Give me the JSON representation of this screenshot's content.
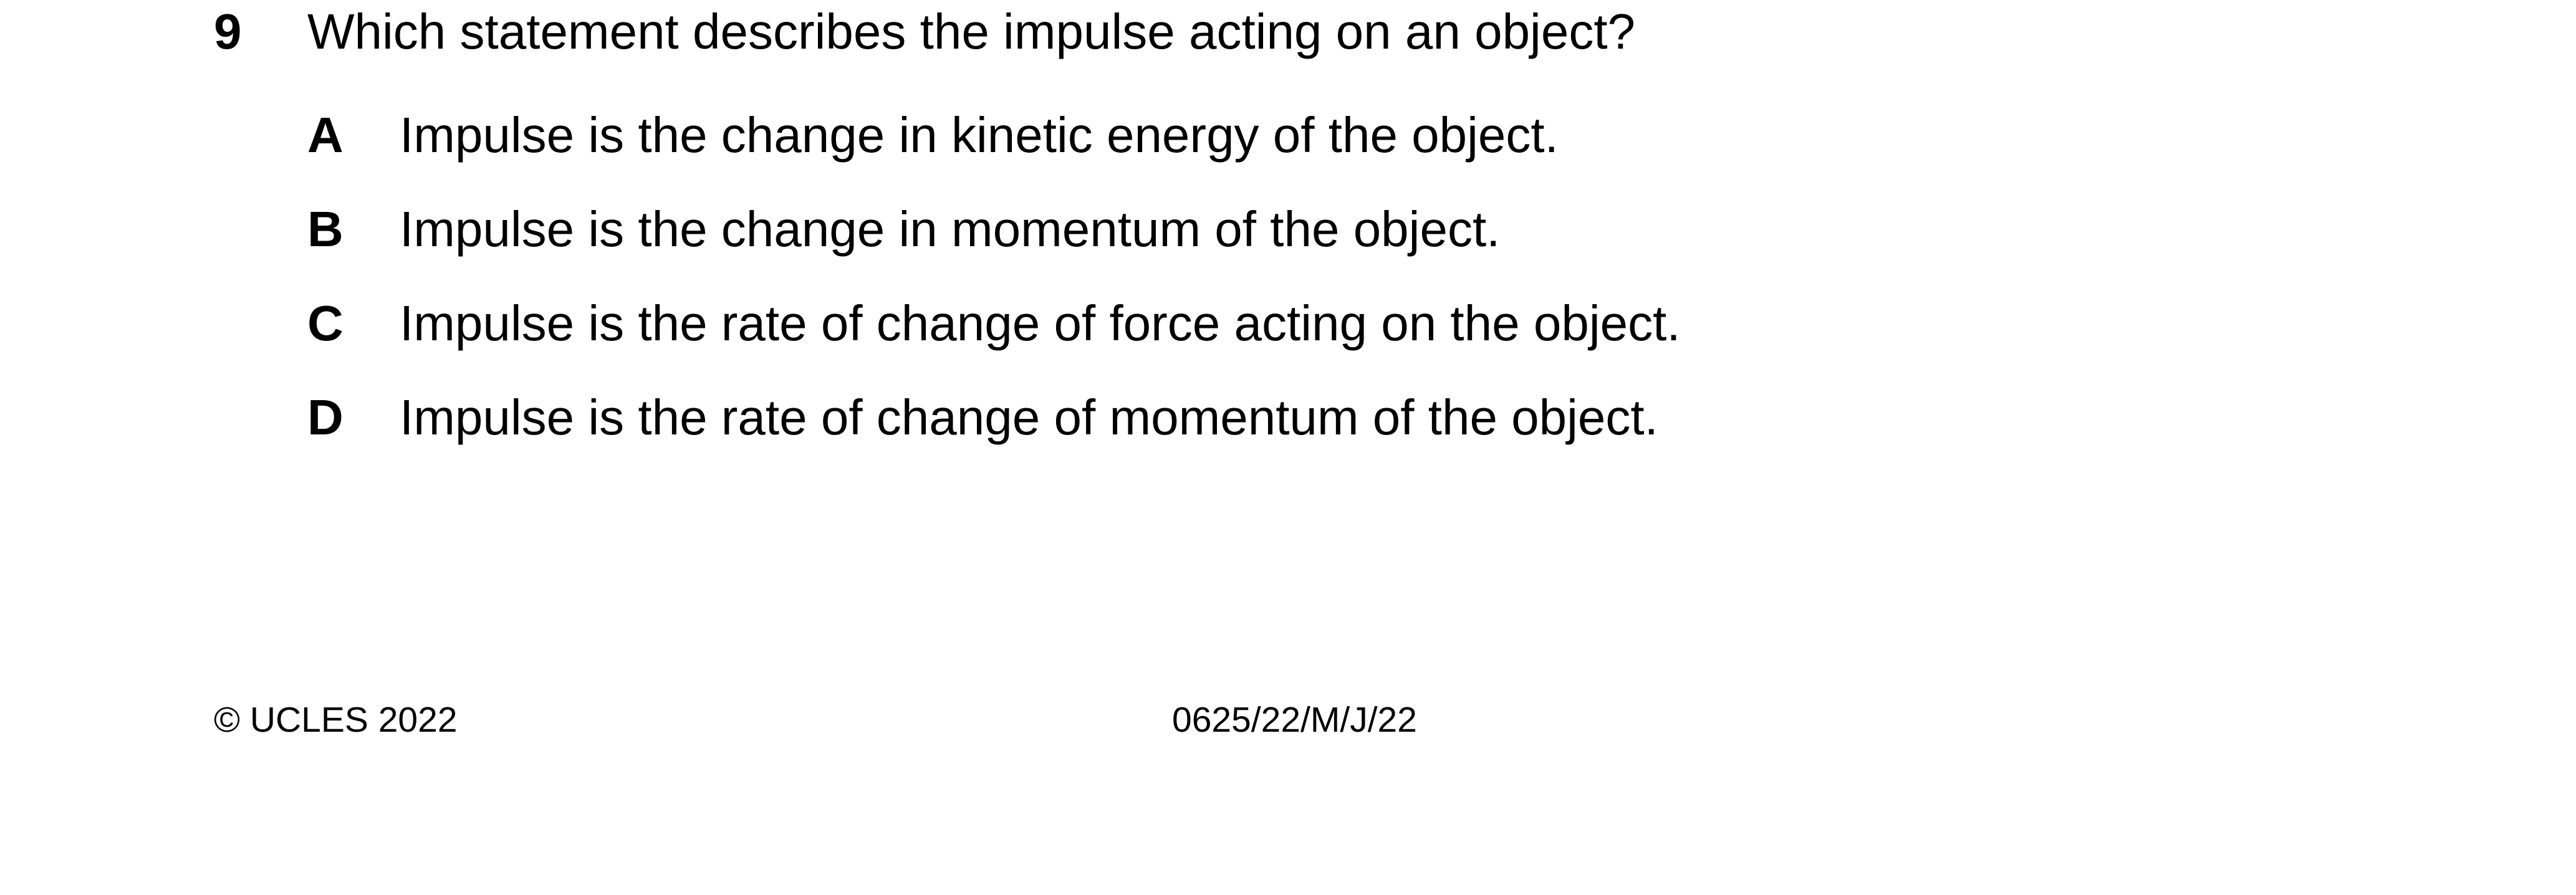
{
  "question": {
    "number": "9",
    "text": "Which statement describes the impulse acting on an object?",
    "options": [
      {
        "letter": "A",
        "text": "Impulse is the change in kinetic energy of the object."
      },
      {
        "letter": "B",
        "text": "Impulse is the change in momentum of the object."
      },
      {
        "letter": "C",
        "text": "Impulse is the rate of change of force acting on the object."
      },
      {
        "letter": "D",
        "text": "Impulse is the rate of change of momentum of the object."
      }
    ]
  },
  "footer": {
    "copyright": "© UCLES 2022",
    "paper_code": "0625/22/M/J/22"
  }
}
